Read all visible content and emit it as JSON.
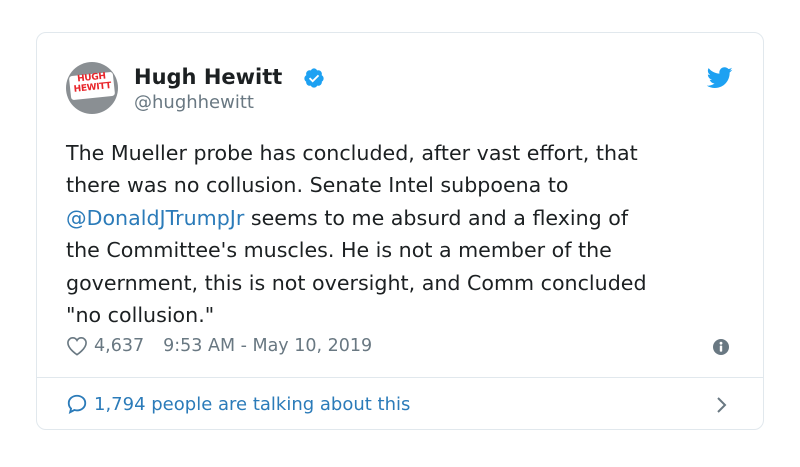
{
  "author": {
    "display_name": "Hugh Hewitt",
    "handle": "@hughhewitt",
    "avatar_text": "HUGH HEWITT"
  },
  "tweet": {
    "lines": [
      {
        "parts": [
          {
            "text": "The Mueller probe has concluded, after vast effort, that"
          }
        ]
      },
      {
        "parts": [
          {
            "text": "there was no collusion. Senate Intel subpoena to"
          }
        ]
      },
      {
        "parts": [
          {
            "text": "@DonaldJTrumpJr",
            "mention": true
          },
          {
            "text": " seems to me absurd and a flexing of"
          }
        ]
      },
      {
        "parts": [
          {
            "text": "the Committee's muscles.  He is not a member of the"
          }
        ]
      },
      {
        "parts": [
          {
            "text": "government, this is not oversight, and Comm concluded"
          }
        ]
      },
      {
        "parts": [
          {
            "text": "\"no collusion.\""
          }
        ]
      }
    ]
  },
  "meta": {
    "likes": "4,637",
    "timestamp": "9:53 AM - May 10, 2019"
  },
  "footer": {
    "label": "1,794 people are talking about this"
  },
  "colors": {
    "link": "#2b7bb9",
    "verified": "#1da1f2",
    "muted": "#697882",
    "border": "#e1e8ed"
  },
  "icons": [
    "verified-badge-icon",
    "twitter-bird-icon",
    "heart-icon",
    "info-icon",
    "speech-bubble-icon",
    "chevron-right-icon"
  ]
}
